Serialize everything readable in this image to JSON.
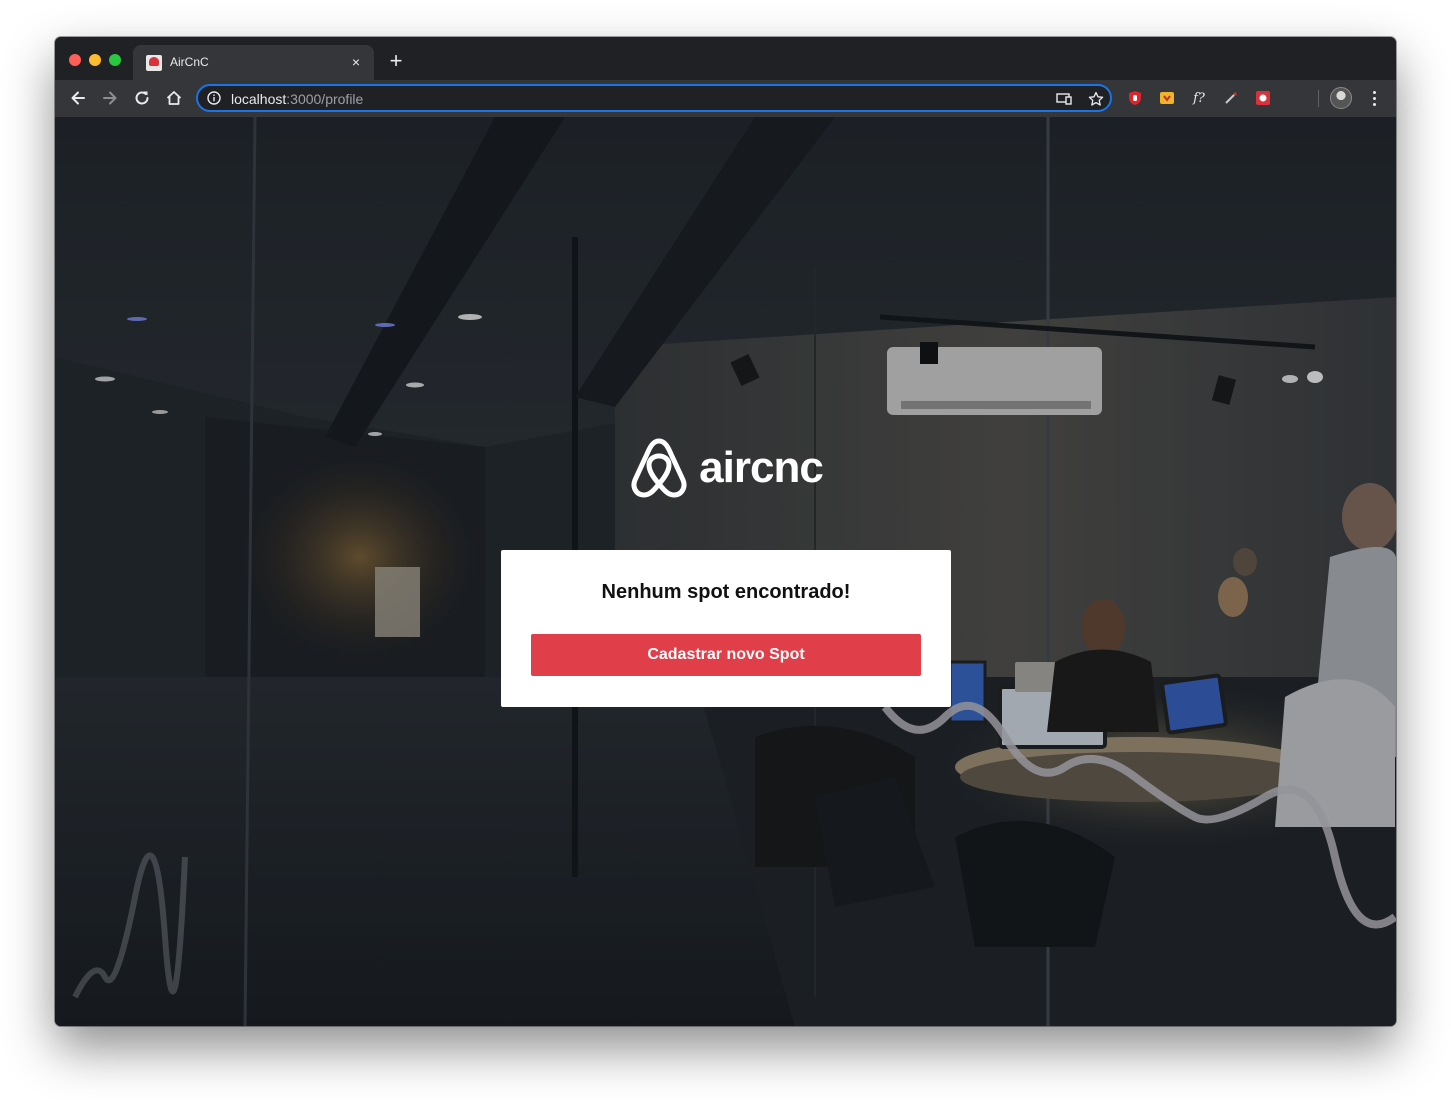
{
  "browser": {
    "tab": {
      "title": "AirCnC",
      "favicon": "aircnc-favicon"
    },
    "new_tab_label": "+",
    "tab_close_label": "×",
    "address": {
      "host": "localhost",
      "path": ":3000/profile"
    },
    "icons": {
      "back": "arrow-left-icon",
      "forward": "arrow-right-icon",
      "reload": "reload-icon",
      "home": "home-icon",
      "info": "info-icon",
      "cast": "cast-icon",
      "bookmark": "star-icon",
      "menu": "kebab-menu-icon"
    },
    "extensions": [
      {
        "name": "ublock-icon",
        "color": "#e0242b"
      },
      {
        "name": "ext-yellow-icon",
        "color": "#f0b429"
      },
      {
        "name": "whatfont-icon",
        "glyph": "f?"
      },
      {
        "name": "eyedropper-icon",
        "color": "#c0392b"
      },
      {
        "name": "ext-red-icon",
        "color": "#d8323c"
      }
    ]
  },
  "page": {
    "brand": "aircnc",
    "empty_message": "Nenhum spot encontrado!",
    "cta_label": "Cadastrar novo Spot",
    "accent_color": "#e03e49"
  }
}
